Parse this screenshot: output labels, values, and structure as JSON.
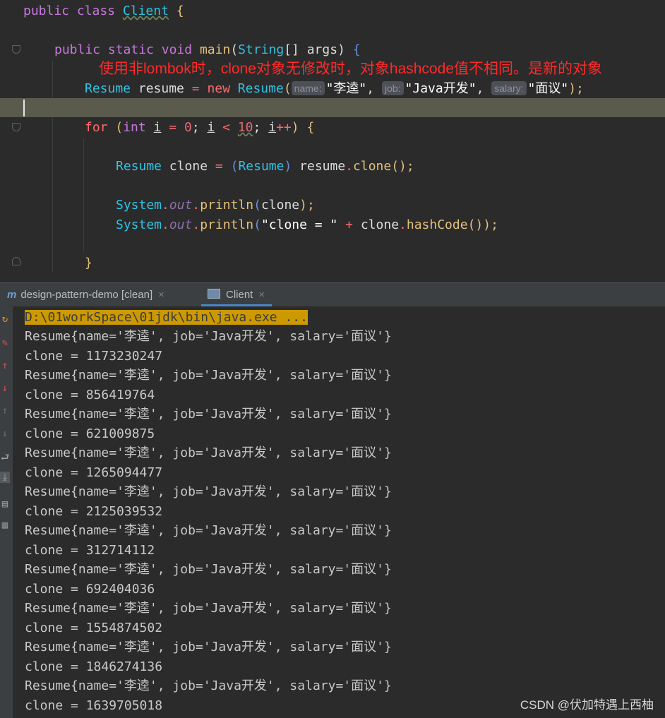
{
  "editor": {
    "line1": {
      "kw1": "public",
      "kw2": "class",
      "name": "Client",
      "brace": "{"
    },
    "line2": {
      "kw1": "public",
      "kw2": "static",
      "kw3": "void",
      "name": "main",
      "type": "String",
      "brackets": "[]",
      "param": "args",
      "brace": "{"
    },
    "annotation": "使用非lombok时，clone对象无修改时，对象hashcode值不相同。是新的对象",
    "line3": {
      "type": "Resume",
      "var": "resume",
      "eq": "=",
      "kw": "new",
      "ctor": "Resume",
      "hint_name": "name:",
      "arg_name": "\"李逵\"",
      "hint_job": "job:",
      "arg_job": "\"Java开发\"",
      "hint_salary": "salary:",
      "arg_salary": "\"面议\"",
      "end": ");"
    },
    "line4": {
      "kw": "for",
      "type": "int",
      "var": "i",
      "init": "0",
      "limit": "10",
      "inc": "++",
      "brace": "{"
    },
    "line5": {
      "type": "Resume",
      "var": "clone",
      "eq": "=",
      "cast": "Resume",
      "target": "resume",
      "method": "clone",
      "end": "();"
    },
    "line6": {
      "cls": "System",
      "field": "out",
      "method": "println",
      "arg": "clone",
      "end": ");"
    },
    "line7": {
      "cls": "System",
      "field": "out",
      "method": "println",
      "str": "\"clone = \"",
      "plus": "+",
      "target": "clone",
      "method2": "hashCode",
      "end": "());"
    },
    "line8": {
      "brace": "}"
    }
  },
  "tabs": [
    {
      "label": "design-pattern-demo [clean]",
      "icon": "m",
      "close": "×"
    },
    {
      "label": "Client",
      "close": "×"
    }
  ],
  "toolbar_icons": [
    "rerun-icon",
    "edit-config-icon",
    "up-arrow-icon",
    "down-arrow-icon",
    "up-gray-icon",
    "down-gray-icon",
    "soft-wrap-icon",
    "scroll-to-end-icon",
    "print-icon",
    "trash-icon"
  ],
  "console": {
    "command": "D:\\01workSpace\\01jdk\\bin\\java.exe ...",
    "lines": [
      "Resume{name='李逵', job='Java开发', salary='面议'}",
      "clone = 1173230247",
      "Resume{name='李逵', job='Java开发', salary='面议'}",
      "clone = 856419764",
      "Resume{name='李逵', job='Java开发', salary='面议'}",
      "clone = 621009875",
      "Resume{name='李逵', job='Java开发', salary='面议'}",
      "clone = 1265094477",
      "Resume{name='李逵', job='Java开发', salary='面议'}",
      "clone = 2125039532",
      "Resume{name='李逵', job='Java开发', salary='面议'}",
      "clone = 312714112",
      "Resume{name='李逵', job='Java开发', salary='面议'}",
      "clone = 692404036",
      "Resume{name='李逵', job='Java开发', salary='面议'}",
      "clone = 1554874502",
      "Resume{name='李逵', job='Java开发', salary='面议'}",
      "clone = 1846274136",
      "Resume{name='李逵', job='Java开发', salary='面议'}",
      "clone = 1639705018"
    ]
  },
  "watermark": "CSDN @伏加特遇上西柚"
}
